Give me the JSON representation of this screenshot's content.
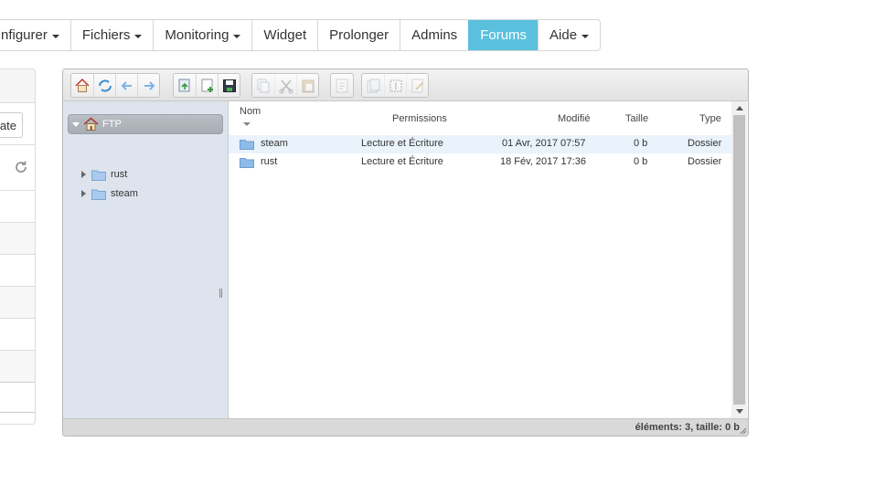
{
  "nav": {
    "items": [
      {
        "label": "nfigurer",
        "caret": true,
        "active": false
      },
      {
        "label": "Fichiers",
        "caret": true,
        "active": false
      },
      {
        "label": "Monitoring",
        "caret": true,
        "active": false
      },
      {
        "label": "Widget",
        "caret": false,
        "active": false
      },
      {
        "label": "Prolonger",
        "caret": false,
        "active": false
      },
      {
        "label": "Admins",
        "caret": false,
        "active": false
      },
      {
        "label": "Forums",
        "caret": false,
        "active": true
      },
      {
        "label": "Aide",
        "caret": true,
        "active": false
      }
    ],
    "active_color": "#5bc0de"
  },
  "left_panel": {
    "update_label": "date"
  },
  "file_manager": {
    "toolbar": {
      "groups": [
        [
          "home-icon",
          "refresh-icon",
          "back-arrow-icon",
          "forward-arrow-icon"
        ],
        [
          "upload-icon",
          "new-file-icon",
          "save-icon"
        ],
        [
          "copy-icon",
          "cut-icon",
          "paste-icon"
        ],
        [
          "info-icon"
        ],
        [
          "duplicate-icon",
          "rename-icon",
          "edit-icon"
        ]
      ]
    },
    "tree": {
      "root": "FTP",
      "children": [
        "rust",
        "steam"
      ]
    },
    "columns": {
      "name": "Nom",
      "permissions": "Permissions",
      "modified": "Modifié",
      "size": "Taille",
      "type": "Type"
    },
    "rows": [
      {
        "name": "steam",
        "permissions": "Lecture et Écriture",
        "modified": "01 Avr, 2017 07:57",
        "size": "0 b",
        "type": "Dossier"
      },
      {
        "name": "rust",
        "permissions": "Lecture et Écriture",
        "modified": "18 Fév, 2017 17:36",
        "size": "0 b",
        "type": "Dossier"
      }
    ],
    "status": "éléments: 3, taille: 0 b"
  }
}
